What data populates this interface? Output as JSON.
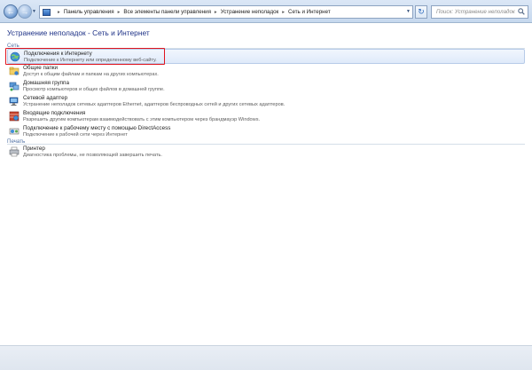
{
  "address_bar": {
    "breadcrumbs": [
      "Панель управления",
      "Все элементы панели управления",
      "Устранение неполадок",
      "Сеть и Интернет"
    ]
  },
  "search": {
    "placeholder": "Поиск: Устранение неполадок"
  },
  "page": {
    "title": "Устранение неполадок - Сеть и Интернет"
  },
  "groups": [
    {
      "label": "Сеть",
      "items": [
        {
          "title": "Подключения к Интернету",
          "description": "Подключение к Интернету или определенному веб-сайту.",
          "icon": "internet-connections-icon"
        },
        {
          "title": "Общие папки",
          "description": "Доступ к общим файлам и папкам на других компьютерах.",
          "icon": "shared-folders-icon"
        },
        {
          "title": "Домашняя группа",
          "description": "Просмотр компьютеров и общих файлов в домашней группе.",
          "icon": "homegroup-icon"
        },
        {
          "title": "Сетевой адаптер",
          "description": "Устранение неполадок сетевых адаптеров Ethernet, адаптеров беспроводных сетей и других сетевых адаптеров.",
          "icon": "network-adapter-icon"
        },
        {
          "title": "Входящие подключения",
          "description": "Разрешить другим компьютерам взаимодействовать с этим компьютером через брандмауэр Windows.",
          "icon": "incoming-connections-icon"
        },
        {
          "title": "Подключение к рабочему месту с помощью DirectAccess",
          "description": "Подключение к рабочей сети через Интернет",
          "icon": "directaccess-icon"
        }
      ]
    },
    {
      "label": "Печать",
      "items": [
        {
          "title": "Принтер",
          "description": "Диагностика проблемы, не позволяющей завершить печать.",
          "icon": "printer-icon"
        }
      ]
    }
  ],
  "colors": {
    "title": "#1e3287",
    "group_label": "#4e6fa3",
    "highlight_border": "#e0141e"
  }
}
